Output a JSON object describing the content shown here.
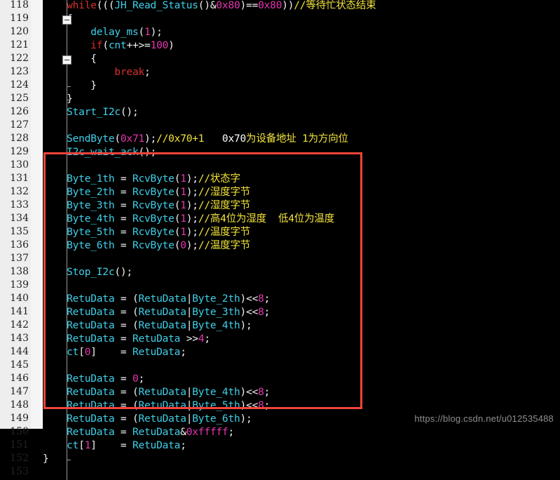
{
  "editor": {
    "background_color": "#000000",
    "gutter_color": "#eeeeee",
    "first_line_number": 118,
    "last_line_number": 153,
    "line_height_px": 19
  },
  "highlight_box": {
    "color": "#f4433c",
    "starts_at_line": 131,
    "ends_at_line": 151
  },
  "watermark": {
    "text": "https://blog.csdn.net/u012535488"
  },
  "gutter": {
    "line_numbers": [
      "118",
      "119",
      "120",
      "121",
      "122",
      "123",
      "124",
      "125",
      "126",
      "127",
      "128",
      "129",
      "130",
      "131",
      "132",
      "133",
      "134",
      "135",
      "136",
      "137",
      "138",
      "139",
      "140",
      "141",
      "142",
      "143",
      "144",
      "145",
      "146",
      "147",
      "148",
      "149",
      "150",
      "151",
      "152",
      "153"
    ],
    "fold_boxes": [
      "119",
      "122"
    ],
    "fold_ticks": [
      "124",
      "125",
      "152"
    ]
  },
  "code": {
    "lines": [
      {
        "n": "118",
        "text": "    while(((JH_Read_Status()&0x80)==0x80))//等待忙状态结束"
      },
      {
        "n": "119",
        "text": "    {"
      },
      {
        "n": "120",
        "text": "        delay_ms(1);"
      },
      {
        "n": "121",
        "text": "        if(cnt++>=100)"
      },
      {
        "n": "122",
        "text": "        {"
      },
      {
        "n": "123",
        "text": "            break;"
      },
      {
        "n": "124",
        "text": "        }"
      },
      {
        "n": "125",
        "text": "    }"
      },
      {
        "n": "126",
        "text": "    Start_I2c();"
      },
      {
        "n": "127",
        "text": ""
      },
      {
        "n": "128",
        "text": "    SendByte(0x71);//0x70+1   0x70为设备地址 1为方向位"
      },
      {
        "n": "129",
        "text": "    I2c_wait_ack();"
      },
      {
        "n": "130",
        "text": ""
      },
      {
        "n": "131",
        "text": "    Byte_1th = RcvByte(1);//状态字"
      },
      {
        "n": "132",
        "text": "    Byte_2th = RcvByte(1);//湿度字节"
      },
      {
        "n": "133",
        "text": "    Byte_3th = RcvByte(1);//湿度字节"
      },
      {
        "n": "134",
        "text": "    Byte_4th = RcvByte(1);//高4位为湿度  低4位为温度"
      },
      {
        "n": "135",
        "text": "    Byte_5th = RcvByte(1);//温度字节"
      },
      {
        "n": "136",
        "text": "    Byte_6th = RcvByte(0);//温度字节"
      },
      {
        "n": "137",
        "text": ""
      },
      {
        "n": "138",
        "text": "    Stop_I2c();"
      },
      {
        "n": "139",
        "text": ""
      },
      {
        "n": "140",
        "text": "    RetuData = (RetuData|Byte_2th)<<8;"
      },
      {
        "n": "141",
        "text": "    RetuData = (RetuData|Byte_3th)<<8;"
      },
      {
        "n": "142",
        "text": "    RetuData = (RetuData|Byte_4th);"
      },
      {
        "n": "143",
        "text": "    RetuData = RetuData >>4;"
      },
      {
        "n": "144",
        "text": "    ct[0]    = RetuData;"
      },
      {
        "n": "145",
        "text": ""
      },
      {
        "n": "146",
        "text": "    RetuData = 0;"
      },
      {
        "n": "147",
        "text": "    RetuData = (RetuData|Byte_4th)<<8;"
      },
      {
        "n": "148",
        "text": "    RetuData = (RetuData|Byte_5th)<<8;"
      },
      {
        "n": "149",
        "text": "    RetuData = (RetuData|Byte_6th);"
      },
      {
        "n": "150",
        "text": "    RetuData = RetuData&0xfffff;"
      },
      {
        "n": "151",
        "text": "    ct[1]    = RetuData;"
      },
      {
        "n": "152",
        "text": "}"
      },
      {
        "n": "153",
        "text": ""
      }
    ],
    "tokens": [
      [
        [
          "sp",
          "    "
        ],
        [
          "kw",
          "while"
        ],
        [
          "punc",
          "((("
        ],
        [
          "id",
          "JH_Read_Status"
        ],
        [
          "punc",
          "()"
        ],
        [
          "op",
          "&"
        ],
        [
          "num",
          "0x80"
        ],
        [
          "punc",
          ")"
        ],
        [
          "op",
          "=="
        ],
        [
          "num",
          "0x80"
        ],
        [
          "punc",
          "))"
        ],
        [
          "cmt",
          "//等待忙状态结束"
        ]
      ],
      [
        [
          "sp",
          "    "
        ],
        [
          "punc",
          "{"
        ]
      ],
      [
        [
          "sp",
          "        "
        ],
        [
          "id",
          "delay_ms"
        ],
        [
          "punc",
          "("
        ],
        [
          "num",
          "1"
        ],
        [
          "punc",
          ");"
        ]
      ],
      [
        [
          "sp",
          "        "
        ],
        [
          "kw",
          "if"
        ],
        [
          "punc",
          "("
        ],
        [
          "id",
          "cnt"
        ],
        [
          "op",
          "++>="
        ],
        [
          "num",
          "100"
        ],
        [
          "punc",
          ")"
        ]
      ],
      [
        [
          "sp",
          "        "
        ],
        [
          "punc",
          "{"
        ]
      ],
      [
        [
          "sp",
          "            "
        ],
        [
          "kw",
          "break"
        ],
        [
          "punc",
          ";"
        ]
      ],
      [
        [
          "sp",
          "        "
        ],
        [
          "punc",
          "}"
        ]
      ],
      [
        [
          "sp",
          "    "
        ],
        [
          "punc",
          "}"
        ]
      ],
      [
        [
          "sp",
          "    "
        ],
        [
          "id",
          "Start_I2c"
        ],
        [
          "punc",
          "();"
        ]
      ],
      [],
      [
        [
          "sp",
          "    "
        ],
        [
          "id",
          "SendByte"
        ],
        [
          "punc",
          "("
        ],
        [
          "num",
          "0x71"
        ],
        [
          "punc",
          ");"
        ],
        [
          "cmt",
          "//0x70+1   "
        ],
        [
          "cmtw",
          "0x70"
        ],
        [
          "cmt",
          "为设备地址 1为方向位"
        ]
      ],
      [
        [
          "sp",
          "    "
        ],
        [
          "id",
          "I2c_wait_ack"
        ],
        [
          "punc",
          "();"
        ]
      ],
      [],
      [
        [
          "sp",
          "    "
        ],
        [
          "id",
          "Byte_1th"
        ],
        [
          "punc",
          " = "
        ],
        [
          "id",
          "RcvByte"
        ],
        [
          "punc",
          "("
        ],
        [
          "num",
          "1"
        ],
        [
          "punc",
          ");"
        ],
        [
          "cmt",
          "//状态字"
        ]
      ],
      [
        [
          "sp",
          "    "
        ],
        [
          "id",
          "Byte_2th"
        ],
        [
          "punc",
          " = "
        ],
        [
          "id",
          "RcvByte"
        ],
        [
          "punc",
          "("
        ],
        [
          "num",
          "1"
        ],
        [
          "punc",
          ");"
        ],
        [
          "cmt",
          "//湿度字节"
        ]
      ],
      [
        [
          "sp",
          "    "
        ],
        [
          "id",
          "Byte_3th"
        ],
        [
          "punc",
          " = "
        ],
        [
          "id",
          "RcvByte"
        ],
        [
          "punc",
          "("
        ],
        [
          "num",
          "1"
        ],
        [
          "punc",
          ");"
        ],
        [
          "cmt",
          "//湿度字节"
        ]
      ],
      [
        [
          "sp",
          "    "
        ],
        [
          "id",
          "Byte_4th"
        ],
        [
          "punc",
          " = "
        ],
        [
          "id",
          "RcvByte"
        ],
        [
          "punc",
          "("
        ],
        [
          "num",
          "1"
        ],
        [
          "punc",
          ");"
        ],
        [
          "cmt",
          "//高4位为湿度  低4位为温度"
        ]
      ],
      [
        [
          "sp",
          "    "
        ],
        [
          "id",
          "Byte_5th"
        ],
        [
          "punc",
          " = "
        ],
        [
          "id",
          "RcvByte"
        ],
        [
          "punc",
          "("
        ],
        [
          "num",
          "1"
        ],
        [
          "punc",
          ");"
        ],
        [
          "cmt",
          "//温度字节"
        ]
      ],
      [
        [
          "sp",
          "    "
        ],
        [
          "id",
          "Byte_6th"
        ],
        [
          "punc",
          " = "
        ],
        [
          "id",
          "RcvByte"
        ],
        [
          "punc",
          "("
        ],
        [
          "num",
          "0"
        ],
        [
          "punc",
          ");"
        ],
        [
          "cmt",
          "//温度字节"
        ]
      ],
      [],
      [
        [
          "sp",
          "    "
        ],
        [
          "id",
          "Stop_I2c"
        ],
        [
          "punc",
          "();"
        ]
      ],
      [],
      [
        [
          "sp",
          "    "
        ],
        [
          "id",
          "RetuData"
        ],
        [
          "punc",
          " = ("
        ],
        [
          "id",
          "RetuData"
        ],
        [
          "op",
          "|"
        ],
        [
          "id",
          "Byte_2th"
        ],
        [
          "punc",
          ")"
        ],
        [
          "op",
          "<<"
        ],
        [
          "num",
          "8"
        ],
        [
          "punc",
          ";"
        ]
      ],
      [
        [
          "sp",
          "    "
        ],
        [
          "id",
          "RetuData"
        ],
        [
          "punc",
          " = ("
        ],
        [
          "id",
          "RetuData"
        ],
        [
          "op",
          "|"
        ],
        [
          "id",
          "Byte_3th"
        ],
        [
          "punc",
          ")"
        ],
        [
          "op",
          "<<"
        ],
        [
          "num",
          "8"
        ],
        [
          "punc",
          ";"
        ]
      ],
      [
        [
          "sp",
          "    "
        ],
        [
          "id",
          "RetuData"
        ],
        [
          "punc",
          " = ("
        ],
        [
          "id",
          "RetuData"
        ],
        [
          "op",
          "|"
        ],
        [
          "id",
          "Byte_4th"
        ],
        [
          "punc",
          ");"
        ]
      ],
      [
        [
          "sp",
          "    "
        ],
        [
          "id",
          "RetuData"
        ],
        [
          "punc",
          " = "
        ],
        [
          "id",
          "RetuData"
        ],
        [
          "op",
          " >>"
        ],
        [
          "num",
          "4"
        ],
        [
          "punc",
          ";"
        ]
      ],
      [
        [
          "sp",
          "    "
        ],
        [
          "id",
          "ct"
        ],
        [
          "punc",
          "["
        ],
        [
          "num",
          "0"
        ],
        [
          "punc",
          "]    = "
        ],
        [
          "id",
          "RetuData"
        ],
        [
          "punc",
          ";"
        ]
      ],
      [],
      [
        [
          "sp",
          "    "
        ],
        [
          "id",
          "RetuData"
        ],
        [
          "punc",
          " = "
        ],
        [
          "num",
          "0"
        ],
        [
          "punc",
          ";"
        ]
      ],
      [
        [
          "sp",
          "    "
        ],
        [
          "id",
          "RetuData"
        ],
        [
          "punc",
          " = ("
        ],
        [
          "id",
          "RetuData"
        ],
        [
          "op",
          "|"
        ],
        [
          "id",
          "Byte_4th"
        ],
        [
          "punc",
          ")"
        ],
        [
          "op",
          "<<"
        ],
        [
          "num",
          "8"
        ],
        [
          "punc",
          ";"
        ]
      ],
      [
        [
          "sp",
          "    "
        ],
        [
          "id",
          "RetuData"
        ],
        [
          "punc",
          " = ("
        ],
        [
          "id",
          "RetuData"
        ],
        [
          "op",
          "|"
        ],
        [
          "id",
          "Byte_5th"
        ],
        [
          "punc",
          ")"
        ],
        [
          "op",
          "<<"
        ],
        [
          "num",
          "8"
        ],
        [
          "punc",
          ";"
        ]
      ],
      [
        [
          "sp",
          "    "
        ],
        [
          "id",
          "RetuData"
        ],
        [
          "punc",
          " = ("
        ],
        [
          "id",
          "RetuData"
        ],
        [
          "op",
          "|"
        ],
        [
          "id",
          "Byte_6th"
        ],
        [
          "punc",
          ");"
        ]
      ],
      [
        [
          "sp",
          "    "
        ],
        [
          "id",
          "RetuData"
        ],
        [
          "punc",
          " = "
        ],
        [
          "id",
          "RetuData"
        ],
        [
          "op",
          "&"
        ],
        [
          "num",
          "0xfffff"
        ],
        [
          "punc",
          ";"
        ]
      ],
      [
        [
          "sp",
          "    "
        ],
        [
          "id",
          "ct"
        ],
        [
          "punc",
          "["
        ],
        [
          "num",
          "1"
        ],
        [
          "punc",
          "]    = "
        ],
        [
          "id",
          "RetuData"
        ],
        [
          "punc",
          ";"
        ]
      ],
      [
        [
          "punc",
          "}"
        ]
      ],
      []
    ]
  }
}
